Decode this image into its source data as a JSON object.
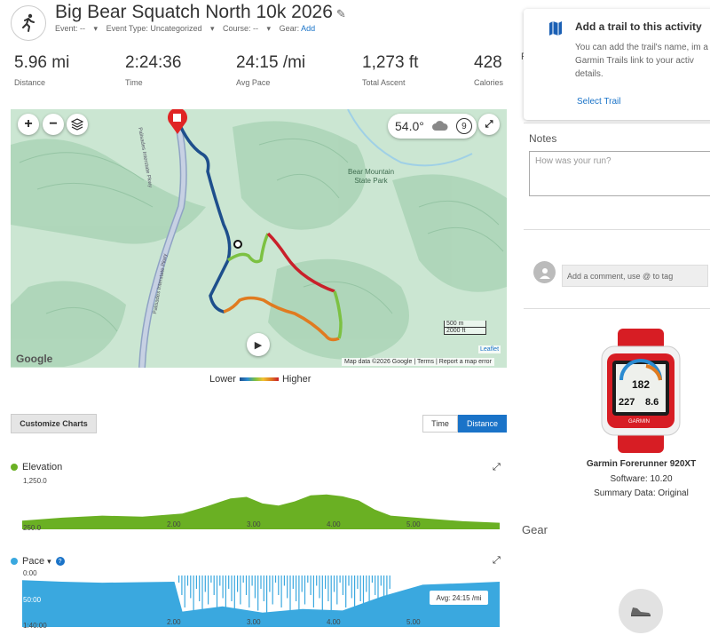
{
  "activity": {
    "title": "Big Bear Squatch North 10k 2026",
    "meta": {
      "event": "Event: --",
      "event_type": "Event Type: Uncategorized",
      "course": "Course: --",
      "gear_label": "Gear:",
      "gear_add": "Add"
    }
  },
  "stats": [
    {
      "value": "5.96 mi",
      "label": "Distance"
    },
    {
      "value": "2:24:36",
      "label": "Time"
    },
    {
      "value": "24:15 /mi",
      "label": "Avg Pace"
    },
    {
      "value": "1,273 ft",
      "label": "Total Ascent"
    },
    {
      "value": "428",
      "label": "Calories"
    }
  ],
  "map": {
    "temperature": "54.0°",
    "wind_speed": "9",
    "place_label": "Bear Mountain\nState Park",
    "road_label_1": "Palisades Interstate Pkwy",
    "road_label_2": "Palisades Interstate Pkwy",
    "scale_metric": "500 m",
    "scale_imperial": "2000 ft",
    "footer_data": "Map data ©2026 Google",
    "footer_terms": "Terms",
    "footer_report": "Report a map error",
    "leaflet": "Leaflet",
    "google": "Google",
    "legend_lower": "Lower",
    "legend_higher": "Higher"
  },
  "charts_controls": {
    "customize": "Customize Charts",
    "time": "Time",
    "distance": "Distance"
  },
  "elevation_chart": {
    "title": "Elevation",
    "y_top": "1,250.0",
    "y_bottom": "250.0",
    "x_ticks": [
      "2.00",
      "3.00",
      "4.00",
      "5.00"
    ],
    "color": "#6ab023"
  },
  "pace_chart": {
    "title": "Pace",
    "y_top": "0:00",
    "y_mid": "50:00",
    "y_bottom": "1:40:00",
    "x_ticks": [
      "2.00",
      "3.00",
      "4.00",
      "5.00"
    ],
    "avg": "Avg: 24:15 /mi",
    "color": "#3aa8df"
  },
  "chart_data": [
    {
      "type": "area",
      "title": "Elevation",
      "xlabel": "",
      "ylabel": "",
      "ylim": [
        250,
        1250
      ],
      "x": [
        0.0,
        0.5,
        1.0,
        1.5,
        2.0,
        2.3,
        2.6,
        2.8,
        3.0,
        3.2,
        3.4,
        3.6,
        3.8,
        4.0,
        4.2,
        4.4,
        4.6,
        5.0,
        5.5,
        5.96
      ],
      "series": [
        {
          "values": [
            420,
            480,
            520,
            500,
            560,
            700,
            860,
            890,
            760,
            720,
            800,
            920,
            940,
            900,
            820,
            640,
            520,
            470,
            410,
            380
          ]
        }
      ]
    },
    {
      "type": "area",
      "title": "Pace",
      "xlabel": "",
      "ylabel": "",
      "ylim": [
        0,
        100
      ],
      "x": [
        0.0,
        0.5,
        1.0,
        1.5,
        1.9,
        2.0,
        2.5,
        3.0,
        3.5,
        4.0,
        4.5,
        5.0,
        5.5,
        5.96
      ],
      "series": [
        {
          "values": [
            9,
            12,
            14,
            13,
            12,
            70,
            60,
            72,
            65,
            68,
            40,
            18,
            15,
            12
          ]
        }
      ]
    }
  ],
  "trail_card": {
    "heading": "Add a trail to this activity",
    "body": "You can add the trail's name, im a Garmin Trails link to your activ details.",
    "link": "Select Trail"
  },
  "notes": {
    "label": "Notes",
    "placeholder": "How was your run?"
  },
  "comment": {
    "placeholder": "Add a comment, use @ to tag"
  },
  "device": {
    "name": "Garmin Forerunner 920XT",
    "software": "Software: 10.20",
    "summary": "Summary Data: Original",
    "screen_hr": "182",
    "screen_a": "227",
    "screen_b": "8.6",
    "screen_brand": "GARMIN"
  },
  "gear": {
    "label": "Gear"
  },
  "right_edge_letter": "P"
}
